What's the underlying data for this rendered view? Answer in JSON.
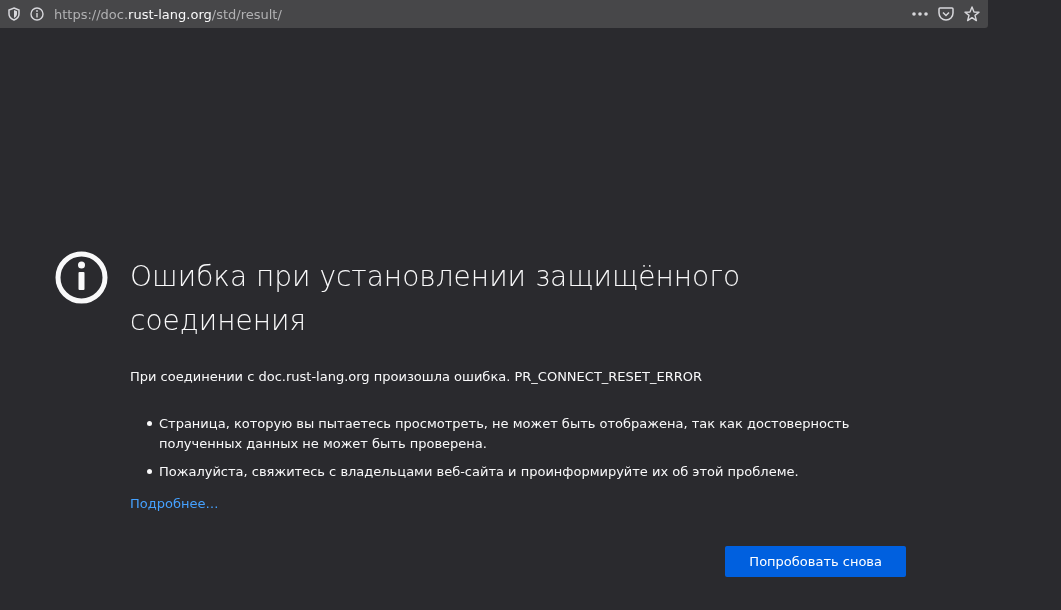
{
  "address_bar": {
    "url_prefix": "https://doc.",
    "url_domain": "rust-lang.org",
    "url_path": "/std/result/"
  },
  "error": {
    "title": "Ошибка при установлении защищённого соединения",
    "message": "При соединении с doc.rust-lang.org произошла ошибка. PR_CONNECT_RESET_ERROR",
    "bullets": [
      "Страница, которую вы пытаетесь просмотреть, не может быть отображена, так как достоверность полученных данных не может быть проверена.",
      "Пожалуйста, свяжитесь с владельцами веб-сайта и проинформируйте их об этой проблеме."
    ],
    "link": "Подробнее…",
    "button": "Попробовать снова"
  }
}
